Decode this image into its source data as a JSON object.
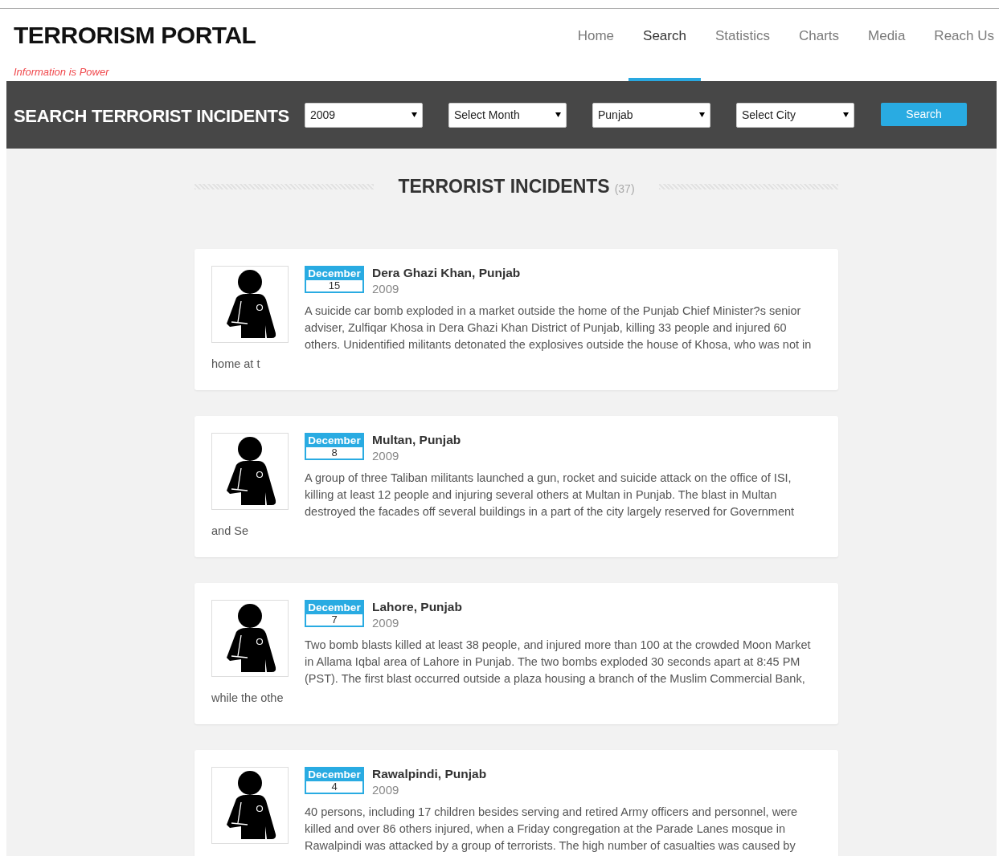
{
  "site": {
    "title": "TERRORISM PORTAL",
    "tagline": "Information is Power"
  },
  "nav": [
    {
      "label": "Home",
      "selected": false
    },
    {
      "label": "Search",
      "selected": true
    },
    {
      "label": "Statistics",
      "selected": false
    },
    {
      "label": "Charts",
      "selected": false
    },
    {
      "label": "Media",
      "selected": false
    },
    {
      "label": "Reach Us",
      "selected": false
    }
  ],
  "search_bar": {
    "title": "SEARCH TERRORIST INCIDENTS",
    "filters": [
      {
        "value": "2009"
      },
      {
        "value": "Select Month"
      },
      {
        "value": "Punjab"
      },
      {
        "value": "Select City"
      }
    ],
    "button": "Search"
  },
  "results": {
    "title": "TERRORIST INCIDENTS",
    "count": "(37)"
  },
  "incidents": [
    {
      "month": "December",
      "day": "15",
      "location": "Dera Ghazi Khan, Punjab",
      "year": "2009",
      "description": "A suicide car bomb exploded in a market outside the home of the Punjab Chief Minister?s senior adviser, Zulfiqar Khosa in Dera Ghazi Khan District of Punjab, killing 33 people and injured 60 others. Unidentified militants detonated the explosives outside the house of Khosa, who was not in",
      "description_tail": "home at t"
    },
    {
      "month": "December",
      "day": "8",
      "location": "Multan, Punjab",
      "year": "2009",
      "description": "A group of three Taliban militants launched a gun, rocket and suicide attack on the office of ISI, killing at least 12 people and injuring several others at Multan in Punjab. The blast in Multan destroyed the facades off several buildings in a part of the city largely reserved for Government",
      "description_tail": "and Se"
    },
    {
      "month": "December",
      "day": "7",
      "location": "Lahore, Punjab",
      "year": "2009",
      "description": "Two bomb blasts killed at least 38 people, and injured more than 100 at the crowded Moon Market in Allama Iqbal area of Lahore in Punjab. The two bombs exploded 30 seconds apart at 8:45 PM (PST). The first blast occurred outside a plaza housing a branch of the Muslim Commercial Bank,",
      "description_tail": "while the othe"
    },
    {
      "month": "December",
      "day": "4",
      "location": "Rawalpindi, Punjab",
      "year": "2009",
      "description": "40 persons, including 17 children besides serving and retired Army officers and personnel, were killed and over 86 others injured, when a Friday congregation at the Parade Lanes mosque in Rawalpindi was attacked by a group of terrorists. The high number of casualties was caused by"
    }
  ]
}
